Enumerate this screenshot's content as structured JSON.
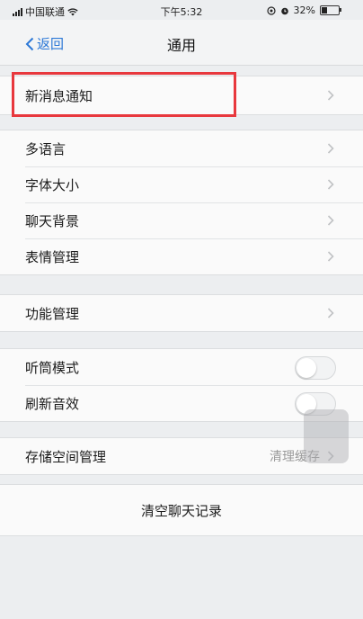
{
  "status_bar": {
    "carrier": "中国联通",
    "time": "下午5:32",
    "battery": "32%"
  },
  "nav": {
    "back_label": "返回",
    "title": "通用"
  },
  "groups": {
    "notifications": [
      "新消息通知"
    ],
    "display": [
      "多语言",
      "字体大小",
      "聊天背景",
      "表情管理"
    ],
    "features": [
      "功能管理"
    ],
    "audio": {
      "earpiece_mode": "听筒模式",
      "refresh_sound": "刷新音效"
    },
    "storage": {
      "label": "存储空间管理",
      "value": "清理缓存"
    }
  },
  "clear_chat_label": "清空聊天记录",
  "colors": {
    "accent": "#2b77d6",
    "highlight": "#e8383d"
  }
}
